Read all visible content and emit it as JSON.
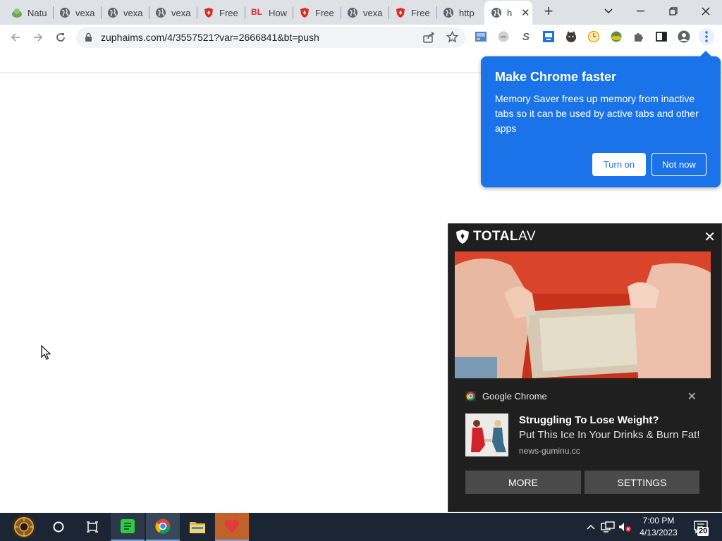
{
  "browser": {
    "tabs": [
      {
        "title": "Natu",
        "icon": "plant-favicon-icon"
      },
      {
        "title": "vexa",
        "icon": "globe-icon"
      },
      {
        "title": "vexa",
        "icon": "globe-icon"
      },
      {
        "title": "vexa",
        "icon": "globe-icon"
      },
      {
        "title": "Free",
        "icon": "shield-favicon-icon"
      },
      {
        "title": "How",
        "icon": "bl-favicon-icon",
        "favicon_text": "BL"
      },
      {
        "title": "Free",
        "icon": "shield-favicon-icon"
      },
      {
        "title": "vexa",
        "icon": "globe-icon"
      },
      {
        "title": "Free",
        "icon": "shield-favicon-icon"
      },
      {
        "title": "http",
        "icon": "globe-icon"
      },
      {
        "title": "h",
        "icon": "globe-icon",
        "active": true
      }
    ],
    "url": "zuphaims.com/4/3557521?var=2666841&bt=push"
  },
  "promo": {
    "title": "Make Chrome faster",
    "body": "Memory Saver frees up memory from inactive tabs so it can be used by active tabs and other apps",
    "turn_on": "Turn on",
    "not_now": "Not now",
    "color": "#1a73e8"
  },
  "notification": {
    "brand_bold": "TOTAL",
    "brand_light": "AV",
    "source": "Google Chrome",
    "title": "Struggling To Lose Weight?",
    "body": "Put This Ice In Your Drinks & Burn Fat!",
    "site": "news-guminu.cc",
    "more": "MORE",
    "settings": "SETTINGS"
  },
  "taskbar": {
    "time": "7:00 PM",
    "date": "4/13/2023",
    "notification_count": "20"
  }
}
